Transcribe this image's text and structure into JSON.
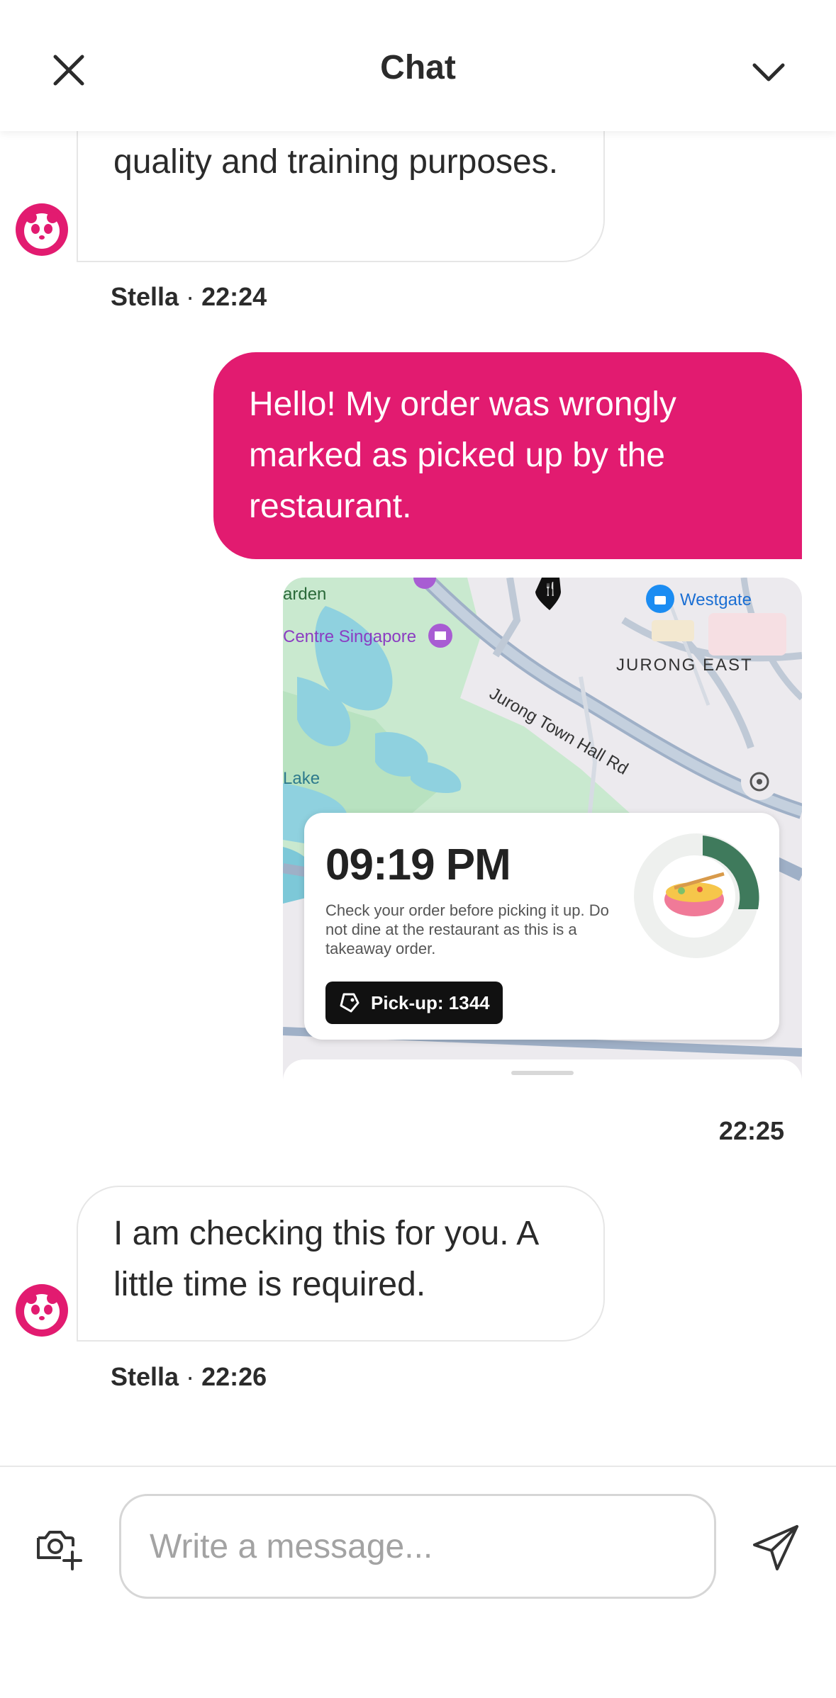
{
  "header": {
    "title": "Chat"
  },
  "messages": [
    {
      "direction": "incoming",
      "text": "quality and training purposes.",
      "sender": "Stella",
      "time": "22:24"
    },
    {
      "direction": "outgoing",
      "text": "Hello! My order was wrongly marked as picked up by the restaurant.",
      "time": ""
    },
    {
      "direction": "outgoing",
      "type": "image",
      "time": "22:25",
      "map_labels": {
        "garden": "arden",
        "centre": "Centre Singapore",
        "westgate": "Westgate",
        "jurong_east": "JURONG EAST",
        "road": "Jurong Town Hall Rd",
        "lake": "Lake"
      },
      "order_time": "09:19 PM",
      "order_note": "Check your order before picking it up. Do not dine at the restaurant as this is a takeaway order.",
      "pickup_label": "Pick-up: 1344"
    },
    {
      "direction": "incoming",
      "text": "I am checking this for you. A little time is required.",
      "sender": "Stella",
      "time": "22:26"
    }
  ],
  "meta_separator": "·",
  "composer": {
    "placeholder": "Write a message..."
  },
  "colors": {
    "brand": "#e21b70",
    "outgoing_text": "#ffffff"
  },
  "icons": {
    "close": "close-icon",
    "collapse": "chevron-down-icon",
    "avatar": "panda-avatar-icon",
    "camera": "camera-add-icon",
    "send": "send-icon"
  }
}
